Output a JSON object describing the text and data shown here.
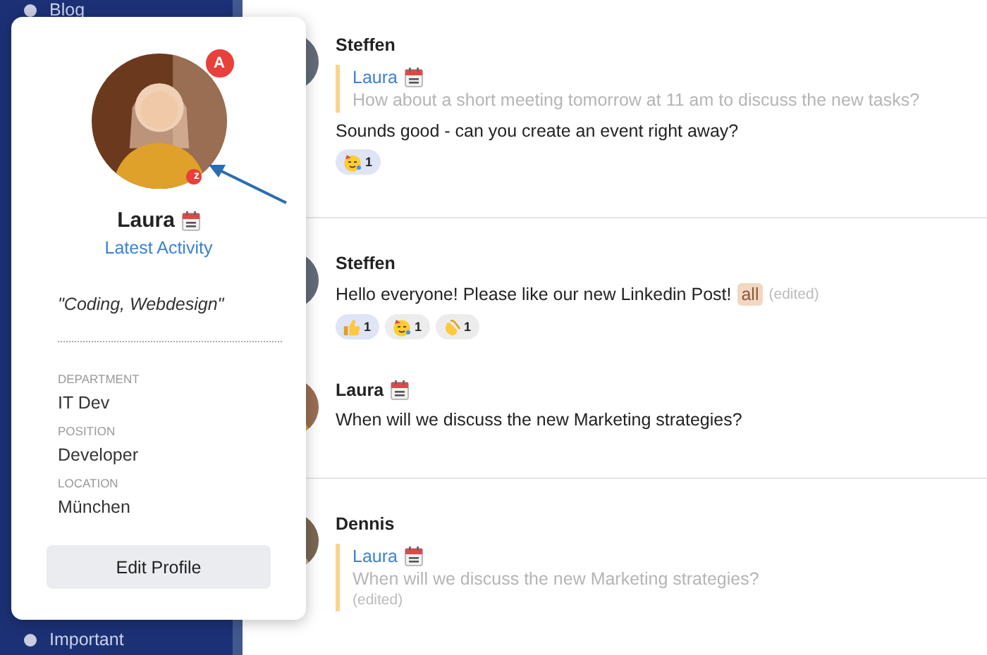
{
  "sidebar": {
    "items": [
      {
        "label": "Blog"
      },
      {
        "label": "Important"
      }
    ]
  },
  "profile_card": {
    "name": "Laura",
    "calendar": true,
    "activity_link": "Latest Activity",
    "avatar_badge": "A",
    "status_badge": "z",
    "bio": "\"Coding, Webdesign\"",
    "fields": [
      {
        "label": "DEPARTMENT",
        "value": "IT Dev"
      },
      {
        "label": "POSITION",
        "value": "Developer"
      },
      {
        "label": "LOCATION",
        "value": "München"
      }
    ],
    "button": "Edit Profile"
  },
  "groups": [
    {
      "messages": [
        {
          "author": "Steffen",
          "calendar": false,
          "quote": {
            "author": "Laura",
            "calendar": true,
            "text": "How about a short meeting tomorrow at 11 am to discuss the new tasks?"
          },
          "text": "Sounds good - can you create an event right away?",
          "reactions": [
            {
              "kind": "party",
              "count": "1",
              "selected": true
            }
          ]
        }
      ]
    },
    {
      "messages": [
        {
          "author": "Steffen",
          "calendar": false,
          "text": "Hello everyone! Please like our new Linkedin Post!",
          "mention": "all",
          "edited": "(edited)",
          "reactions": [
            {
              "kind": "thumbs",
              "count": "1",
              "selected": true
            },
            {
              "kind": "party",
              "count": "1",
              "selected": false
            },
            {
              "kind": "clap",
              "count": "1",
              "selected": false
            }
          ]
        },
        {
          "author": "Laura",
          "calendar": true,
          "text": "When will we discuss the new Marketing strategies?"
        }
      ]
    },
    {
      "messages": [
        {
          "author": "Dennis",
          "calendar": false,
          "quote": {
            "author": "Laura",
            "calendar": true,
            "text": "When will we discuss the new Marketing strategies?",
            "edited": "(edited)"
          }
        }
      ]
    }
  ]
}
